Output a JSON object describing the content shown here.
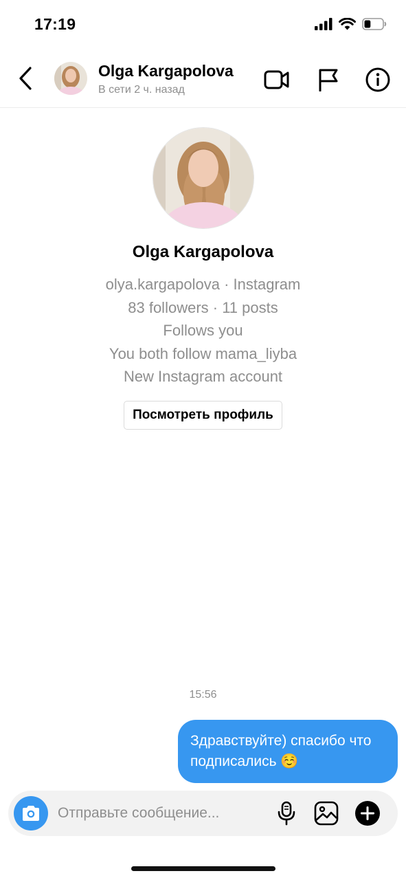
{
  "status_bar": {
    "time": "17:19",
    "battery_level": 0.35
  },
  "header": {
    "name": "Olga Kargapolova",
    "status": "В сети 2 ч. назад",
    "icons": [
      "back-icon",
      "video-call-icon",
      "flag-icon",
      "info-icon"
    ]
  },
  "profile": {
    "name": "Olga Kargapolova",
    "username_line": "olya.kargapolova · Instagram",
    "stats_line": "83 followers · 11 posts",
    "follows_line": "Follows you",
    "mutual_line": "You both follow mama_liyba",
    "account_line": "New Instagram account",
    "view_profile_label": "Посмотреть профиль"
  },
  "messages": [
    {
      "time": "15:56",
      "text": "Здравствуйте) спасибо что подписались ☺️",
      "from": "me"
    }
  ],
  "composer": {
    "placeholder": "Отправьте сообщение...",
    "value": "",
    "icons": [
      "camera-icon",
      "microphone-icon",
      "gallery-icon",
      "add-icon"
    ]
  },
  "colors": {
    "accent": "#3797f0",
    "secondary_text": "#8e8e8e",
    "divider": "#ececec"
  }
}
